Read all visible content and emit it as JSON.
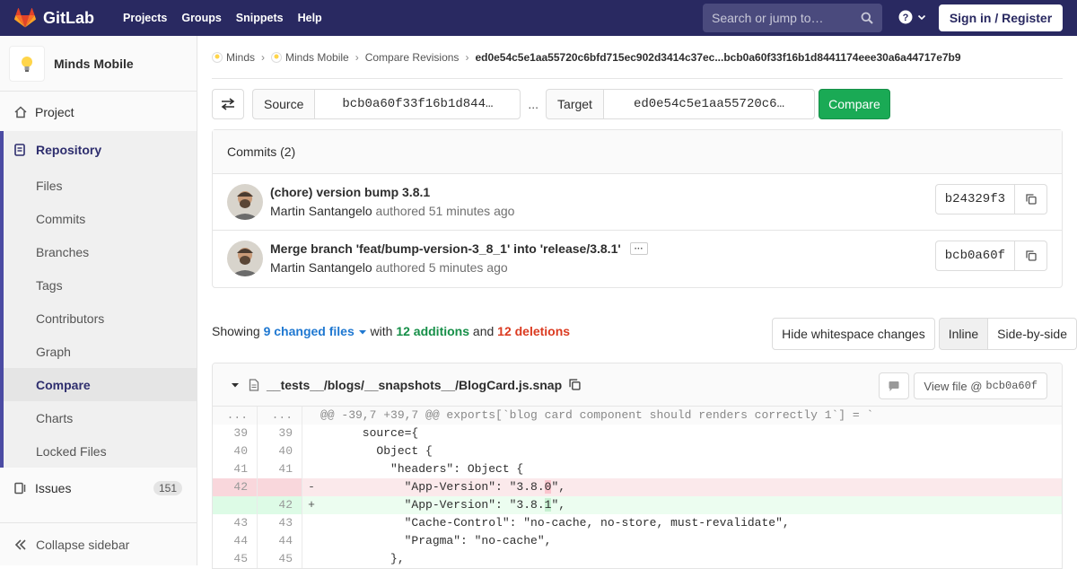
{
  "navbar": {
    "brand": "GitLab",
    "links": [
      "Projects",
      "Groups",
      "Snippets",
      "Help"
    ],
    "search_placeholder": "Search or jump to…",
    "signin_label": "Sign in / Register",
    "colors": {
      "bg": "#292961",
      "accent": "#fc6d26"
    }
  },
  "sidebar": {
    "project_name": "Minds Mobile",
    "project_item": "Project",
    "repository_label": "Repository",
    "repo_items": [
      "Files",
      "Commits",
      "Branches",
      "Tags",
      "Contributors",
      "Graph",
      "Compare",
      "Charts",
      "Locked Files"
    ],
    "active_item": "Compare",
    "issues_label": "Issues",
    "issues_count": "151",
    "collapse_label": "Collapse sidebar"
  },
  "breadcrumb": {
    "items": [
      "Minds",
      "Minds Mobile",
      "Compare Revisions"
    ],
    "current": "ed0e54c5e1aa55720c6bfd715ec902d3414c37ec...bcb0a60f33f16b1d8441174eee30a6a44717e7b9"
  },
  "compare": {
    "source_label": "Source",
    "source_value": "bcb0a60f33f16b1d844…",
    "separator": "...",
    "target_label": "Target",
    "target_value": "ed0e54c5e1aa55720c6…",
    "button_label": "Compare"
  },
  "commits": {
    "heading": "Commits (2)",
    "items": [
      {
        "title": "(chore) version bump 3.8.1",
        "author": "Martin Santangelo",
        "verb": "authored",
        "time": "51 minutes ago",
        "sha": "b24329f3"
      },
      {
        "title": "Merge branch 'feat/bump-version-3_8_1' into 'release/3.8.1'",
        "author": "Martin Santangelo",
        "verb": "authored",
        "time": "5 minutes ago",
        "sha": "bcb0a60f",
        "ellipsis": "···"
      }
    ]
  },
  "summary": {
    "showing": "Showing",
    "files": "9 changed files",
    "with": "with",
    "additions": "12 additions",
    "and": "and",
    "deletions": "12 deletions"
  },
  "diff_options": {
    "whitespace": "Hide whitespace changes",
    "inline": "Inline",
    "side_by_side": "Side-by-side"
  },
  "file": {
    "path": "__tests__/blogs/__snapshots__/BlogCard.js.snap",
    "view_label": "View file @",
    "view_sha": "bcb0a60f",
    "lines": [
      {
        "type": "match",
        "old": "...",
        "new": "...",
        "sign": "",
        "code": "@@ -39,7 +39,7 @@ exports[`blog card component should renders correctly 1`] = `"
      },
      {
        "type": "ctx",
        "old": "39",
        "new": "39",
        "sign": "",
        "code": "      source={"
      },
      {
        "type": "ctx",
        "old": "40",
        "new": "40",
        "sign": "",
        "code": "        Object {"
      },
      {
        "type": "ctx",
        "old": "41",
        "new": "41",
        "sign": "",
        "code": "          \"headers\": Object {"
      },
      {
        "type": "old",
        "old": "42",
        "new": "",
        "sign": "-",
        "code_pre": "            \"App-Version\": \"3.8.",
        "code_hl": "0",
        "code_post": "\","
      },
      {
        "type": "new",
        "old": "",
        "new": "42",
        "sign": "+",
        "code_pre": "            \"App-Version\": \"3.8.",
        "code_hl": "1",
        "code_post": "\","
      },
      {
        "type": "ctx",
        "old": "43",
        "new": "43",
        "sign": "",
        "code": "            \"Cache-Control\": \"no-cache, no-store, must-revalidate\","
      },
      {
        "type": "ctx",
        "old": "44",
        "new": "44",
        "sign": "",
        "code": "            \"Pragma\": \"no-cache\","
      },
      {
        "type": "ctx",
        "old": "45",
        "new": "45",
        "sign": "",
        "code": "          },"
      }
    ]
  }
}
